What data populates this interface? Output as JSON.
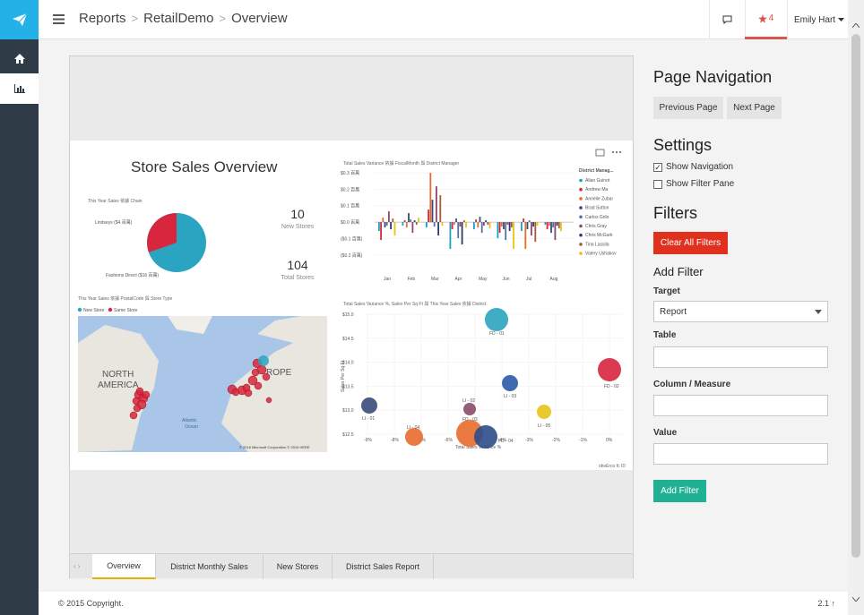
{
  "header": {
    "breadcrumbs": [
      "Reports",
      "RetailDemo",
      "Overview"
    ],
    "notification_count": "4",
    "user_name": "Emily Hart"
  },
  "report": {
    "main_title": "Store Sales Overview",
    "pie_title": "This Year Sales 依據 Chain",
    "pie_labels": [
      "Lindseys ($4 百萬)",
      "Fashions Direct ($16 百萬)"
    ],
    "kpi1_value": "10",
    "kpi1_label": "New Stores",
    "kpi2_value": "104",
    "kpi2_label": "Total Stores",
    "variance_title": "Total Sales Variance 依據 FiscalMonth 與 District Manager",
    "variance_y_ticks": [
      "$0.3 百萬",
      "$0.2 百萬",
      "$0.1 百萬",
      "$0.0 百萬",
      "($0.1 百萬)",
      "($0.2 百萬)"
    ],
    "variance_x_ticks": [
      "Jan",
      "Feb",
      "Mar",
      "Apr",
      "May",
      "Jun",
      "Jul",
      "Aug"
    ],
    "legend_title": "District Manag...",
    "legend_items": [
      {
        "name": "Allan Guinot",
        "color": "#1aa2c5"
      },
      {
        "name": "Andrew Ma",
        "color": "#d7263d"
      },
      {
        "name": "Annelie Zubar",
        "color": "#e86a2d"
      },
      {
        "name": "Brad Sutton",
        "color": "#3a4a78"
      },
      {
        "name": "Carlos Grilo",
        "color": "#5a6fa0"
      },
      {
        "name": "Chris Gray",
        "color": "#8a4a6d"
      },
      {
        "name": "Chris McGurk",
        "color": "#2c3e6a"
      },
      {
        "name": "Tina Lassila",
        "color": "#a35a3a"
      },
      {
        "name": "Valery Ushakov",
        "color": "#e8c21a"
      }
    ],
    "map_title": "This Year Sales 依據 PostalCode 與 Store Type",
    "map_legend": [
      "New Store",
      "Same Store"
    ],
    "map_labels": [
      "NORTH",
      "AMERICA",
      "ROPE",
      "Atlantic",
      "Ocean"
    ],
    "map_credit": "© 2016 Microsoft Corporation   © 2016 HERE",
    "scatter_title": "Total Sales Variance %, Sales Per Sq Ft 與 This Year Sales 依據 District",
    "scatter_y_ticks": [
      "$15.0",
      "$14.5",
      "$14.0",
      "$13.5",
      "$13.0",
      "$12.5"
    ],
    "scatter_x_ticks": [
      "-9%",
      "-8%",
      "-7%",
      "-6%",
      "-5%",
      "-4%",
      "-3%",
      "-2%",
      "-1%",
      "0%"
    ],
    "scatter_y_label": "Sales Per Sq Ft",
    "scatter_x_label": "Total Sales Variance %",
    "scatter_points": [
      "FD - 01",
      "FD - 02",
      "LI - 01",
      "LI - 02",
      "LI - 03",
      "LI - 04",
      "LI - 05",
      "FD - 03",
      "FD - 04"
    ],
    "footer_id": "obvErco fc ID",
    "page_tabs": [
      "Overview",
      "District Monthly Sales",
      "New Stores",
      "District Sales Report"
    ]
  },
  "side": {
    "page_nav_heading": "Page Navigation",
    "prev_label": "Previous Page",
    "next_label": "Next Page",
    "settings_heading": "Settings",
    "show_navigation": "Show Navigation",
    "show_filter_pane": "Show Filter Pane",
    "filters_heading": "Filters",
    "clear_all": "Clear All Filters",
    "add_filter_heading": "Add Filter",
    "target_label": "Target",
    "target_value": "Report",
    "table_label": "Table",
    "column_label": "Column / Measure",
    "value_label": "Value",
    "add_filter_button": "Add Filter"
  },
  "footer": {
    "copyright": "© 2015 Copyright.",
    "version": "2.1"
  },
  "colors": {
    "brand_blue": "#23b1e8",
    "rail": "#2f3b47",
    "danger": "#e0311f",
    "success": "#20b093",
    "accent_tab": "#e8b200"
  }
}
